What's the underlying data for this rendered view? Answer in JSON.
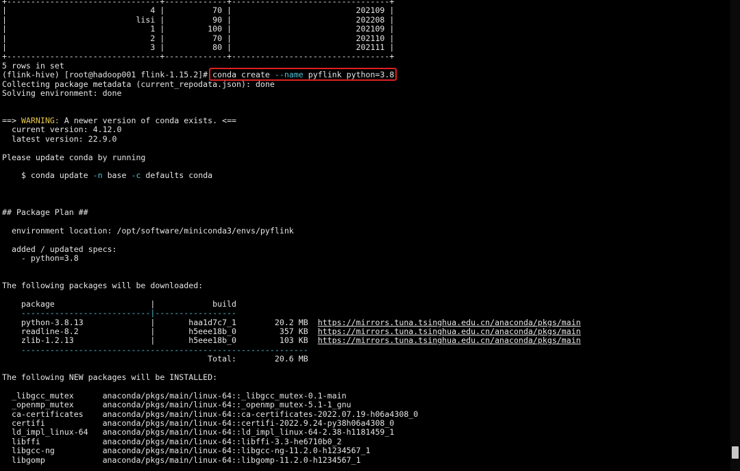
{
  "terminal": {
    "table": {
      "border_top": "+--------------------------------+-------------+---------------------------------+",
      "border_bottom": "+--------------------------------+-------------+---------------------------------+",
      "rows": [
        "|                              4 |          70 |                          202109 |",
        "|                           lisi |          90 |                          202208 |",
        "|                              1 |         100 |                          202109 |",
        "|                              2 |          70 |                          202110 |",
        "|                              3 |          80 |                          202111 |"
      ]
    },
    "rows_in_set": "5 rows in set",
    "prompt": "(flink-hive) [root@hadoop001 flink-1.15.2]#",
    "command": {
      "part1": "conda create ",
      "flag": "--name",
      "part2": " pyflink python=3.8"
    },
    "collecting": "Collecting package metadata (current_repodata.json): done",
    "solving": "Solving environment: done",
    "warning": {
      "prefix": "==> ",
      "label": "WARNING:",
      "text": " A newer version of conda exists. <==",
      "current": "  current version: 4.12.0",
      "latest": "  latest version: 22.9.0"
    },
    "please_update": "Please update conda by running",
    "update_cmd": {
      "p1": "    $ conda update ",
      "f1": "-n",
      "p2": " base ",
      "f2": "-c",
      "p3": " defaults conda"
    },
    "package_plan": "## Package Plan ##",
    "env_location": "  environment location: /opt/software/miniconda3/envs/pyflink",
    "added_specs": "  added / updated specs:",
    "spec_item": "    - python=3.8",
    "downloaded_heading": "The following packages will be downloaded:",
    "dl_header": "    package                    |            build",
    "dl_sep": "    ---------------------------|-----------------",
    "downloads": [
      {
        "left": "    python-3.8.13              |       haa1d7c7_1        20.2 MB  ",
        "url": "https://mirrors.tuna.tsinghua.edu.cn/anaconda/pkgs/main"
      },
      {
        "left": "    readline-8.2               |       h5eee18b_0         357 KB  ",
        "url": "https://mirrors.tuna.tsinghua.edu.cn/anaconda/pkgs/main"
      },
      {
        "left": "    zlib-1.2.13                |       h5eee18b_0         103 KB  ",
        "url": "https://mirrors.tuna.tsinghua.edu.cn/anaconda/pkgs/main"
      }
    ],
    "dl_total_sep": "    ------------------------------------------------------------",
    "dl_total": "                                           Total:        20.6 MB",
    "installed_heading": "The following NEW packages will be INSTALLED:",
    "installed": [
      "  _libgcc_mutex      anaconda/pkgs/main/linux-64::_libgcc_mutex-0.1-main",
      "  _openmp_mutex      anaconda/pkgs/main/linux-64::_openmp_mutex-5.1-1_gnu",
      "  ca-certificates    anaconda/pkgs/main/linux-64::ca-certificates-2022.07.19-h06a4308_0",
      "  certifi            anaconda/pkgs/main/linux-64::certifi-2022.9.24-py38h06a4308_0",
      "  ld_impl_linux-64   anaconda/pkgs/main/linux-64::ld_impl_linux-64-2.38-h1181459_1",
      "  libffi             anaconda/pkgs/main/linux-64::libffi-3.3-he6710b0_2",
      "  libgcc-ng          anaconda/pkgs/main/linux-64::libgcc-ng-11.2.0-h1234567_1",
      "  libgomp            anaconda/pkgs/main/linux-64::libgomp-11.2.0-h1234567_1"
    ]
  },
  "colors": {
    "background": "#000000",
    "text": "#e6e6e6",
    "flag": "#4ec2d6",
    "warning": "#e8c84a",
    "highlight_box": "#e02020"
  }
}
